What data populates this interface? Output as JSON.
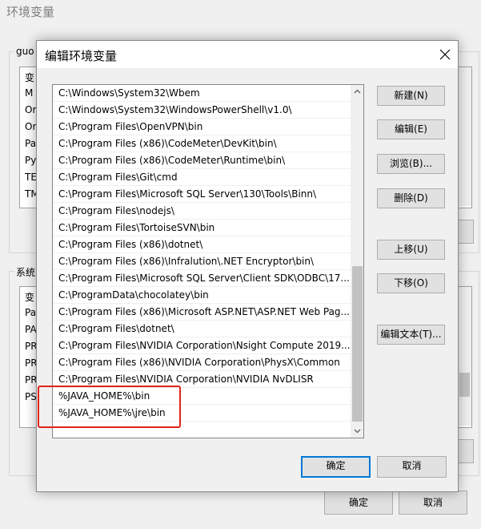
{
  "parent_window": {
    "title": "环境变量",
    "user_group_label": "guo",
    "user_vars": [
      "变",
      "M",
      "Or",
      "Or",
      "Pa",
      "Py",
      "TE",
      "TM"
    ],
    "system_group_label": "系统",
    "system_vars": [
      "变",
      "Pa",
      "PA",
      "PR",
      "PR",
      "PR",
      "PS"
    ],
    "ok_label": "确定",
    "cancel_label": "取消"
  },
  "dialog": {
    "title": "编辑环境变量",
    "paths": [
      "C:\\Windows\\System32\\Wbem",
      "C:\\Windows\\System32\\WindowsPowerShell\\v1.0\\",
      "C:\\Program Files\\OpenVPN\\bin",
      "C:\\Program Files (x86)\\CodeMeter\\DevKit\\bin\\",
      "C:\\Program Files (x86)\\CodeMeter\\Runtime\\bin\\",
      "C:\\Program Files\\Git\\cmd",
      "C:\\Program Files\\Microsoft SQL Server\\130\\Tools\\Binn\\",
      "C:\\Program Files\\nodejs\\",
      "C:\\Program Files\\TortoiseSVN\\bin",
      "C:\\Program Files (x86)\\dotnet\\",
      "C:\\Program Files (x86)\\Infralution\\.NET Encryptor\\bin\\",
      "C:\\Program Files\\Microsoft SQL Server\\Client SDK\\ODBC\\17...",
      "C:\\ProgramData\\chocolatey\\bin",
      "C:\\Program Files (x86)\\Microsoft ASP.NET\\ASP.NET Web Pag...",
      "C:\\Program Files\\dotnet\\",
      "C:\\Program Files\\NVIDIA Corporation\\Nsight Compute 2019....",
      "C:\\Program Files (x86)\\NVIDIA Corporation\\PhysX\\Common",
      "C:\\Program Files\\NVIDIA Corporation\\NVIDIA NvDLISR",
      "%JAVA_HOME%\\bin",
      "%JAVA_HOME%\\jre\\bin"
    ],
    "buttons": {
      "new": "新建(N)",
      "edit": "编辑(E)",
      "browse": "浏览(B)...",
      "delete": "删除(D)",
      "move_up": "上移(U)",
      "move_down": "下移(O)",
      "edit_text": "编辑文本(T)..."
    },
    "ok_label": "确定",
    "cancel_label": "取消"
  },
  "colors": {
    "highlight": "#e2231a",
    "accent": "#0078d7"
  }
}
